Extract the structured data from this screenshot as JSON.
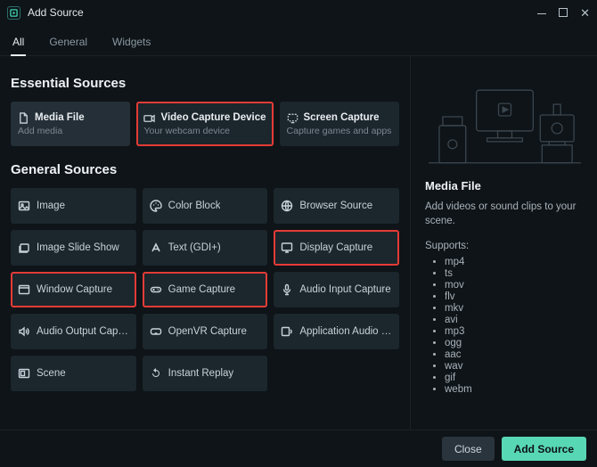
{
  "window": {
    "title": "Add Source"
  },
  "tabs": [
    {
      "label": "All",
      "active": true
    },
    {
      "label": "General",
      "active": false
    },
    {
      "label": "Widgets",
      "active": false
    }
  ],
  "sections": {
    "essential": {
      "heading": "Essential Sources",
      "items": [
        {
          "title": "Media File",
          "subtitle": "Add media",
          "icon": "file-icon",
          "highlight": false
        },
        {
          "title": "Video Capture Device",
          "subtitle": "Your webcam device",
          "icon": "camera-icon",
          "highlight": true
        },
        {
          "title": "Screen Capture",
          "subtitle": "Capture games and apps",
          "icon": "dashed-screen-icon",
          "highlight": false
        }
      ]
    },
    "general": {
      "heading": "General Sources",
      "items": [
        {
          "label": "Image",
          "icon": "image-icon",
          "highlight": false
        },
        {
          "label": "Color Block",
          "icon": "palette-icon",
          "highlight": false
        },
        {
          "label": "Browser Source",
          "icon": "globe-icon",
          "highlight": false
        },
        {
          "label": "Image Slide Show",
          "icon": "slides-icon",
          "highlight": false
        },
        {
          "label": "Text (GDI+)",
          "icon": "text-icon",
          "highlight": false
        },
        {
          "label": "Display Capture",
          "icon": "monitor-icon",
          "highlight": true
        },
        {
          "label": "Window Capture",
          "icon": "window-icon",
          "highlight": true
        },
        {
          "label": "Game Capture",
          "icon": "gamepad-icon",
          "highlight": true
        },
        {
          "label": "Audio Input Capture",
          "icon": "mic-icon",
          "highlight": false
        },
        {
          "label": "Audio Output Capture",
          "icon": "speaker-icon",
          "highlight": false
        },
        {
          "label": "OpenVR Capture",
          "icon": "vr-icon",
          "highlight": false
        },
        {
          "label": "Application Audio Ca...",
          "icon": "app-audio-icon",
          "highlight": false
        },
        {
          "label": "Scene",
          "icon": "scene-icon",
          "highlight": false
        },
        {
          "label": "Instant Replay",
          "icon": "replay-icon",
          "highlight": false
        }
      ]
    }
  },
  "sidebar": {
    "title": "Media File",
    "description": "Add videos or sound clips to your scene.",
    "supports_label": "Supports:",
    "formats": [
      "mp4",
      "ts",
      "mov",
      "flv",
      "mkv",
      "avi",
      "mp3",
      "ogg",
      "aac",
      "wav",
      "gif",
      "webm"
    ]
  },
  "footer": {
    "close": "Close",
    "add": "Add Source"
  }
}
